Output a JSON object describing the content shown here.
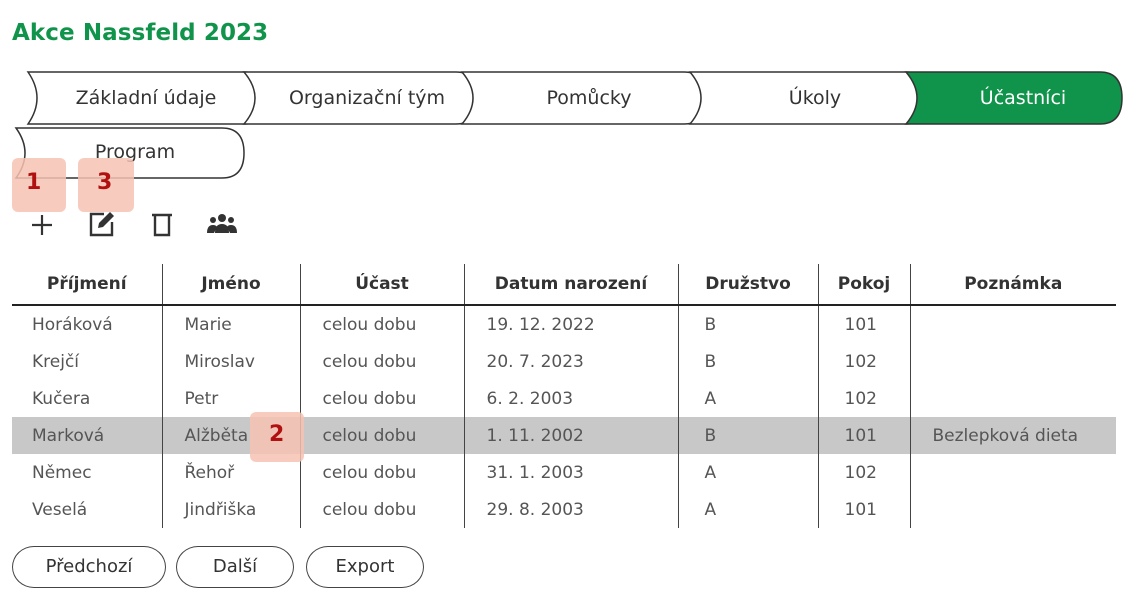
{
  "title": "Akce Nassfeld 2023",
  "colors": {
    "accent": "#10934a",
    "active_tab_bg": "#10934a",
    "selected_row": "#c8c8c8",
    "badge": "#f6c3b3",
    "badge_text": "#b01010"
  },
  "tabs": [
    {
      "label": "Základní údaje",
      "active": false
    },
    {
      "label": "Organizační tým",
      "active": false
    },
    {
      "label": "Pomůcky",
      "active": false
    },
    {
      "label": "Úkoly",
      "active": false
    },
    {
      "label": "Účastníci",
      "active": true
    },
    {
      "label": "Program",
      "active": false
    }
  ],
  "toolbar": {
    "add_icon": "plus-icon",
    "edit_icon": "edit-icon",
    "delete_icon": "trash-icon",
    "group_icon": "group-icon"
  },
  "annotations": {
    "a1": "1",
    "a2": "2",
    "a3": "3"
  },
  "table": {
    "columns": [
      "Příjmení",
      "Jméno",
      "Účast",
      "Datum narození",
      "Družstvo",
      "Pokoj",
      "Poznámka"
    ],
    "rows": [
      {
        "surname": "Horáková",
        "name": "Marie",
        "attendance": "celou dobu",
        "birth": "19. 12. 2022",
        "team": "B",
        "room": "101",
        "note": ""
      },
      {
        "surname": "Krejčí",
        "name": "Miroslav",
        "attendance": "celou dobu",
        "birth": "20. 7. 2023",
        "team": "B",
        "room": "102",
        "note": ""
      },
      {
        "surname": "Kučera",
        "name": "Petr",
        "attendance": "celou dobu",
        "birth": "6. 2. 2003",
        "team": "A",
        "room": "102",
        "note": ""
      },
      {
        "surname": "Marková",
        "name": "Alžběta",
        "attendance": "celou dobu",
        "birth": "1. 11. 2002",
        "team": "B",
        "room": "101",
        "note": "Bezlepková dieta"
      },
      {
        "surname": "Němec",
        "name": "Řehoř",
        "attendance": "celou dobu",
        "birth": "31. 1. 2003",
        "team": "A",
        "room": "102",
        "note": ""
      },
      {
        "surname": "Veselá",
        "name": "Jindřiška",
        "attendance": "celou dobu",
        "birth": "29. 8. 2003",
        "team": "A",
        "room": "101",
        "note": ""
      }
    ],
    "selected_row": 3
  },
  "buttons": {
    "previous": "Předchozí",
    "next": "Další",
    "export": "Export"
  }
}
